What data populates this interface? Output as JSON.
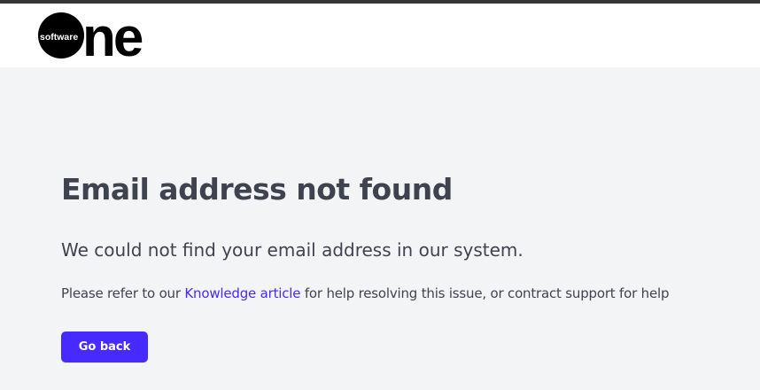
{
  "header": {
    "logo_small_text": "software",
    "logo_large_text": "one"
  },
  "main": {
    "title": "Email address not found",
    "subtitle": "We could not find your email address in our system.",
    "help_prefix": "Please refer to our ",
    "help_link": "Knowledge article",
    "help_suffix": " for help resolving this issue, or contract support for help",
    "back_button": "Go back"
  },
  "colors": {
    "accent": "#472aff",
    "text": "#3f4350",
    "background": "#f3f4f6",
    "top_bar": "#363636"
  }
}
